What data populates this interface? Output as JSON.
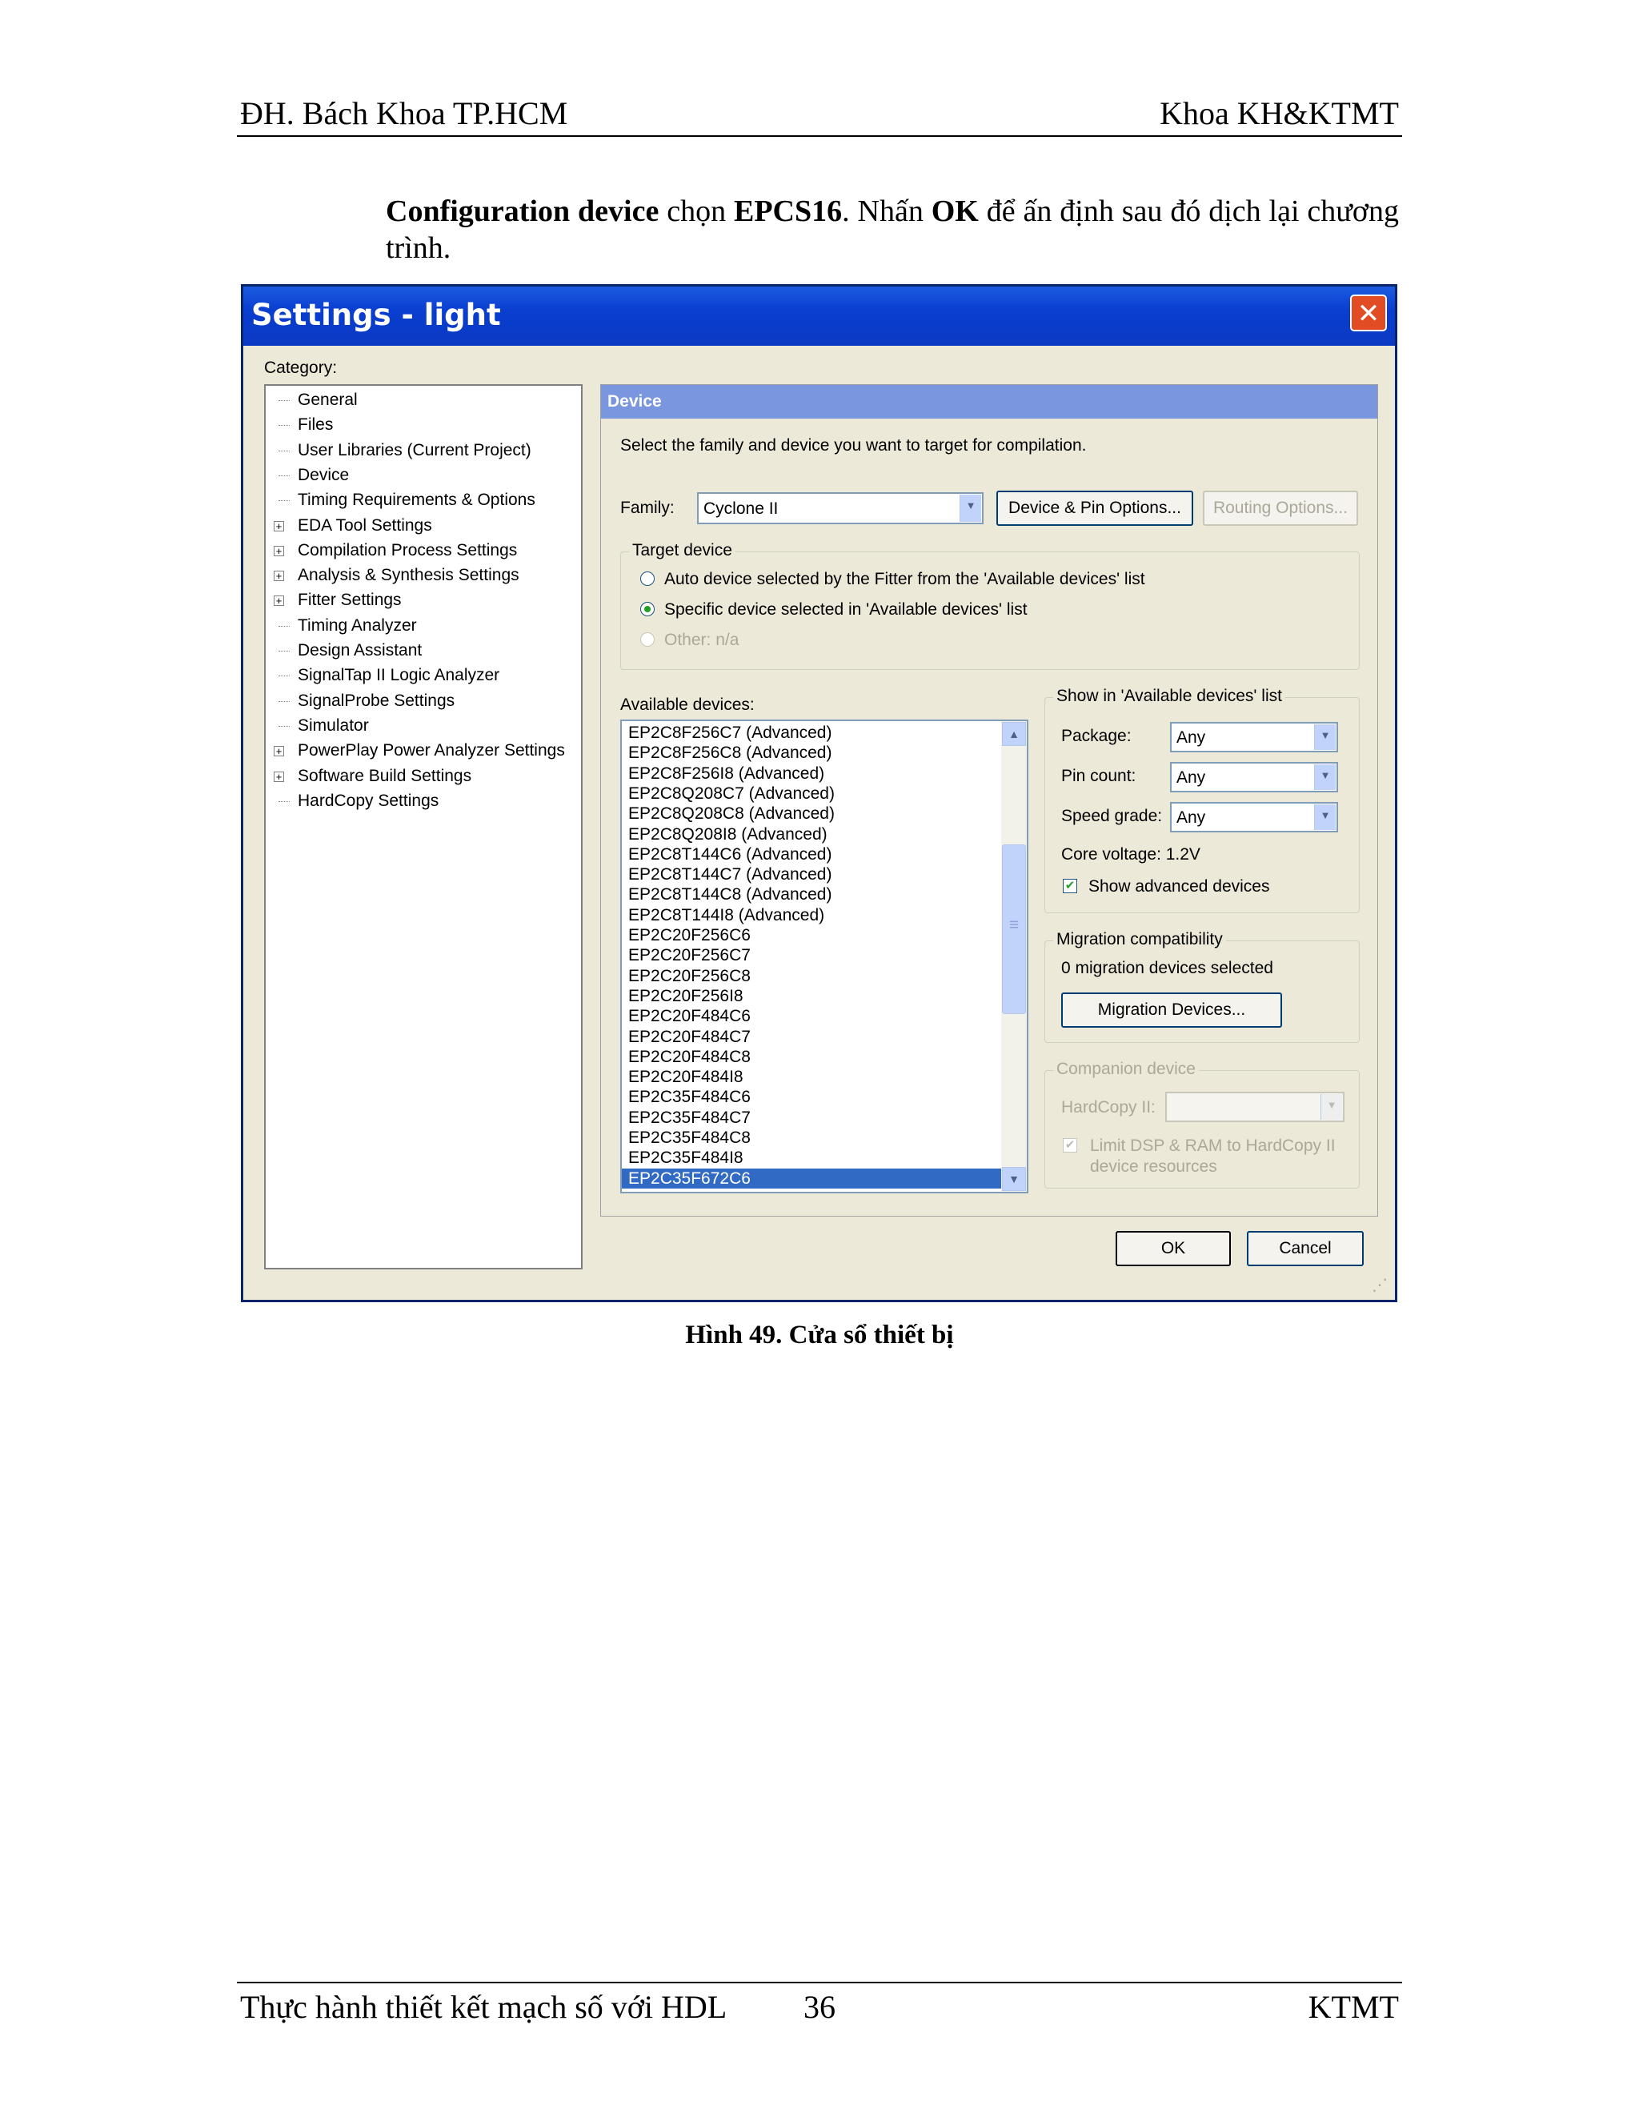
{
  "page": {
    "header_left": "ĐH. Bách Khoa TP.HCM",
    "header_right": "Khoa KH&KTMT",
    "footer_left": "Thực hành thiết kết mạch số với HDL",
    "footer_page": "36",
    "footer_right": "KTMT",
    "caption": "Hình  49. Cửa sổ thiết bị"
  },
  "paragraph": {
    "p1_bold1": "Configuration device",
    "p1_t1": " chọn ",
    "p1_bold2": "EPCS16",
    "p1_t2": ". Nhấn ",
    "p1_bold3": "OK",
    "p1_t3": " để ấn định sau đó dịch lại chương trình."
  },
  "dialog": {
    "title": "Settings - light",
    "close_glyph": "✕",
    "category_label": "Category:",
    "tree": [
      {
        "label": "General",
        "expandable": false
      },
      {
        "label": "Files",
        "expandable": false
      },
      {
        "label": "User Libraries (Current Project)",
        "expandable": false
      },
      {
        "label": "Device",
        "expandable": false
      },
      {
        "label": "Timing Requirements & Options",
        "expandable": false
      },
      {
        "label": "EDA Tool Settings",
        "expandable": true
      },
      {
        "label": "Compilation Process Settings",
        "expandable": true
      },
      {
        "label": "Analysis & Synthesis Settings",
        "expandable": true
      },
      {
        "label": "Fitter Settings",
        "expandable": true
      },
      {
        "label": "Timing Analyzer",
        "expandable": false
      },
      {
        "label": "Design Assistant",
        "expandable": false
      },
      {
        "label": "SignalTap II Logic Analyzer",
        "expandable": false
      },
      {
        "label": "SignalProbe Settings",
        "expandable": false
      },
      {
        "label": "Simulator",
        "expandable": false
      },
      {
        "label": "PowerPlay Power Analyzer Settings",
        "expandable": true
      },
      {
        "label": "Software Build Settings",
        "expandable": true
      },
      {
        "label": "HardCopy Settings",
        "expandable": false
      }
    ],
    "device_header": "Device",
    "instruction": "Select the family and device you want to target for compilation.",
    "family_label": "Family:",
    "family_value": "Cyclone II",
    "device_pin_button": "Device & Pin Options...",
    "routing_button": "Routing Options...",
    "target_group": "Target device",
    "radio_auto": "Auto device selected by the Fitter from the 'Available devices' list",
    "radio_specific": "Specific device selected in 'Available devices' list",
    "radio_other": "Other:  n/a",
    "available_label": "Available devices:",
    "devices": [
      "EP2C8F256C7 (Advanced)",
      "EP2C8F256C8 (Advanced)",
      "EP2C8F256I8 (Advanced)",
      "EP2C8Q208C7 (Advanced)",
      "EP2C8Q208C8 (Advanced)",
      "EP2C8Q208I8 (Advanced)",
      "EP2C8T144C6 (Advanced)",
      "EP2C8T144C7 (Advanced)",
      "EP2C8T144C8 (Advanced)",
      "EP2C8T144I8 (Advanced)",
      "EP2C20F256C6",
      "EP2C20F256C7",
      "EP2C20F256C8",
      "EP2C20F256I8",
      "EP2C20F484C6",
      "EP2C20F484C7",
      "EP2C20F484C8",
      "EP2C20F484I8",
      "EP2C35F484C6",
      "EP2C35F484C7",
      "EP2C35F484C8",
      "EP2C35F484I8",
      "EP2C35F672C6"
    ],
    "selected_device": "EP2C35F672C6",
    "show_group": "Show in 'Available devices' list",
    "package_label": "Package:",
    "package_value": "Any",
    "pincount_label": "Pin count:",
    "pincount_value": "Any",
    "speed_label": "Speed grade:",
    "speed_value": "Any",
    "core_voltage": "Core voltage:  1.2V",
    "show_advanced": "Show advanced devices",
    "migration_group": "Migration compatibility",
    "migration_text": "0 migration devices selected",
    "migration_button": "Migration Devices...",
    "companion_group": "Companion device",
    "hardcopy_label": "HardCopy II:",
    "limit_dsp_line1": "Limit DSP & RAM to HardCopy II",
    "limit_dsp_line2": "device resources",
    "ok_button": "OK",
    "cancel_button": "Cancel"
  }
}
